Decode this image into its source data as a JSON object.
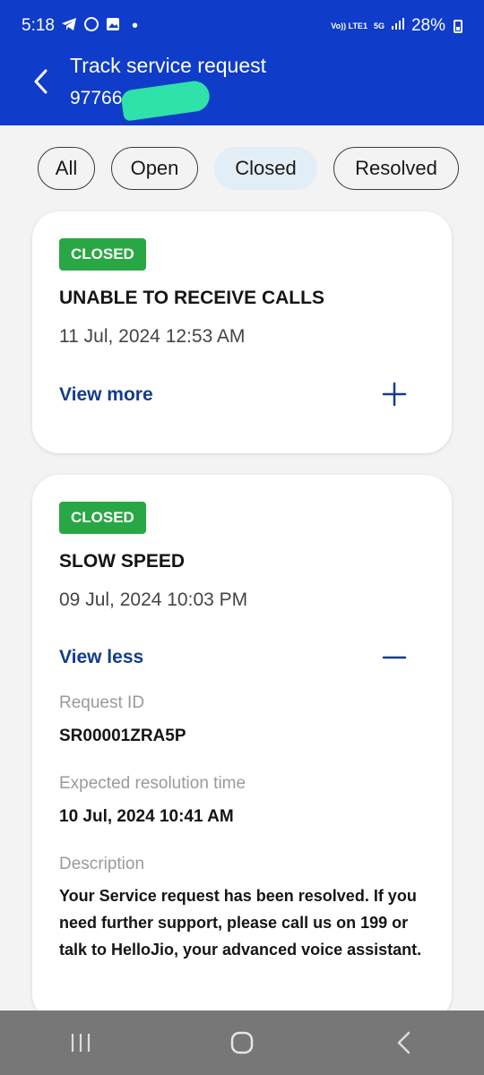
{
  "status_bar": {
    "time": "5:18",
    "battery": "28%",
    "volte_label": "Vo)) LTE1",
    "network_label": "5G"
  },
  "header": {
    "title": "Track service request",
    "subtitle": "97766"
  },
  "filters": [
    {
      "label": "All"
    },
    {
      "label": "Open"
    },
    {
      "label": "Closed",
      "selected": true
    },
    {
      "label": "Resolved"
    }
  ],
  "requests": [
    {
      "status": "CLOSED",
      "title": "UNABLE TO RECEIVE CALLS",
      "date": "11 Jul, 2024  12:53 AM",
      "toggle_label": "View more"
    },
    {
      "status": "CLOSED",
      "title": "SLOW SPEED",
      "date": "09 Jul, 2024  10:03 PM",
      "toggle_label": "View less",
      "details": {
        "request_id_label": "Request ID",
        "request_id": "SR00001ZRA5P",
        "resolution_label": "Expected resolution time",
        "resolution_time": "10 Jul, 2024  10:41 AM",
        "description_label": "Description",
        "description": "Your Service request has been resolved. If you need further support, please call us on 199 or talk to HelloJio, your advanced voice assistant."
      }
    }
  ],
  "colors": {
    "header_bg": "#0f3cc9",
    "badge_green": "#29a744",
    "link_blue": "#133c8b",
    "selected_filter_bg": "#e3edf5"
  }
}
